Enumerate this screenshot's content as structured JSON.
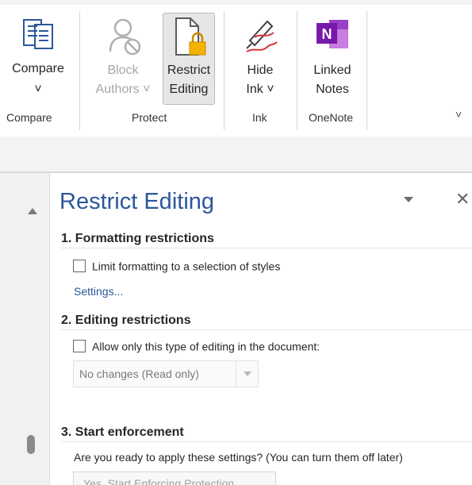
{
  "ribbon": {
    "groups": [
      {
        "label": "Compare"
      },
      {
        "label": "Protect"
      },
      {
        "label": "Ink"
      },
      {
        "label": "OneNote"
      }
    ],
    "compare_label": "Compare",
    "compare_chevron": "˅",
    "block_line1": "Block",
    "block_line2": "Authors ˅",
    "restrict_line1": "Restrict",
    "restrict_line2": "Editing",
    "hide_line1": "Hide",
    "hide_line2": "Ink ˅",
    "linked_line1": "Linked",
    "linked_line2": "Notes",
    "collapse_glyph": "˅",
    "onenote_letter": "N"
  },
  "pane": {
    "title": "Restrict Editing",
    "close_glyph": "✕",
    "section1": {
      "heading": "1. Formatting restrictions",
      "checkbox_label": "Limit formatting to a selection of styles",
      "link": "Settings..."
    },
    "section2": {
      "heading": "2. Editing restrictions",
      "checkbox_label": "Allow only this type of editing in the document:",
      "combo_value": "No changes (Read only)"
    },
    "section3": {
      "heading": "3. Start enforcement",
      "text": "Are you ready to apply these settings? (You can turn them off later)",
      "button": "Yes, Start Enforcing Protection"
    }
  },
  "colors": {
    "accent": "#2b579a",
    "onenote": "#7719aa",
    "lock": "#e8a400",
    "ink_red": "#d13438"
  }
}
